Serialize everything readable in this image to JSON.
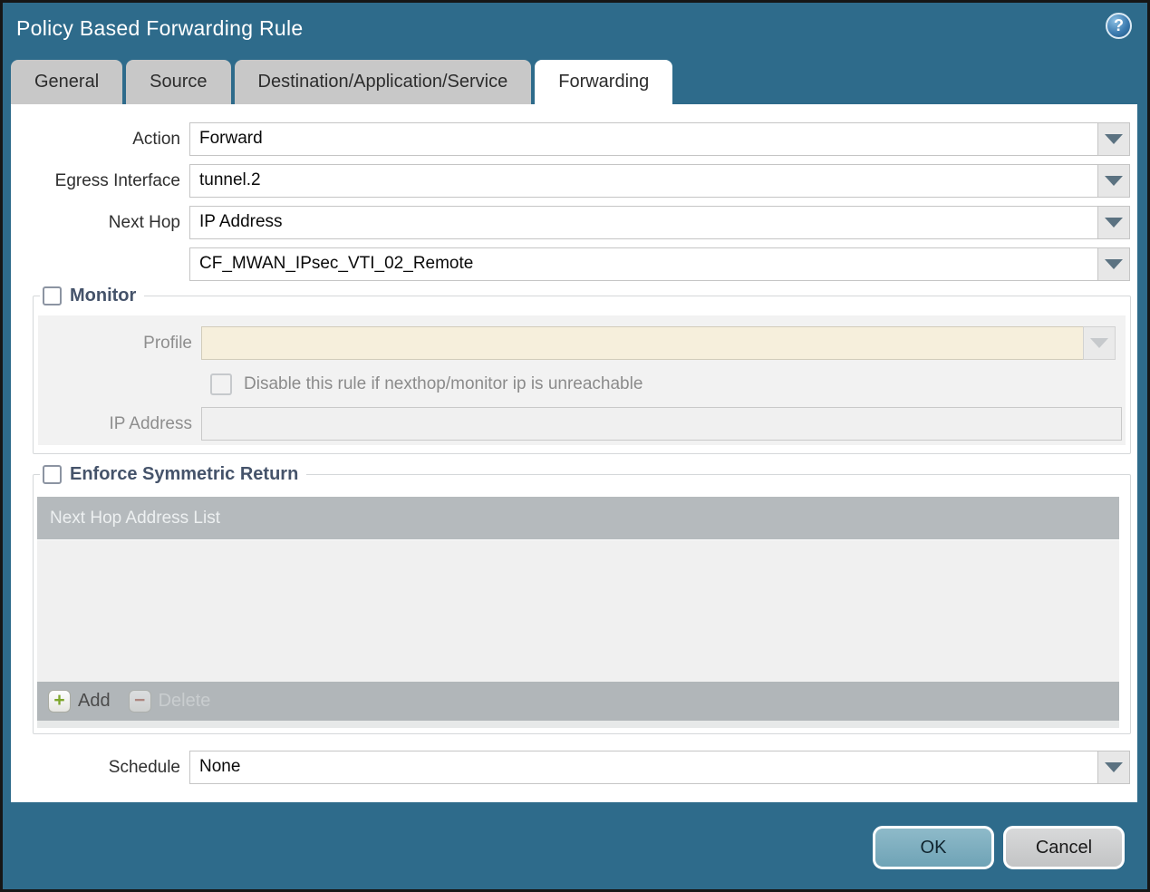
{
  "window": {
    "title": "Policy Based Forwarding Rule"
  },
  "icons": {
    "help": "?",
    "add": "+",
    "delete": "−"
  },
  "tabs": [
    {
      "label": "General",
      "active": false
    },
    {
      "label": "Source",
      "active": false
    },
    {
      "label": "Destination/Application/Service",
      "active": false
    },
    {
      "label": "Forwarding",
      "active": true
    }
  ],
  "form": {
    "action": {
      "label": "Action",
      "value": "Forward"
    },
    "egress_interface": {
      "label": "Egress Interface",
      "value": "tunnel.2"
    },
    "next_hop": {
      "label": "Next Hop",
      "value": "IP Address"
    },
    "next_hop_address": {
      "value": "CF_MWAN_IPsec_VTI_02_Remote"
    },
    "schedule": {
      "label": "Schedule",
      "value": "None"
    }
  },
  "monitor": {
    "title": "Monitor",
    "checked": false,
    "profile": {
      "label": "Profile",
      "value": ""
    },
    "disable_rule_label": "Disable this rule if nexthop/monitor ip is unreachable",
    "disable_rule_checked": false,
    "ip_address": {
      "label": "IP Address",
      "value": ""
    }
  },
  "enforce_symmetric_return": {
    "title": "Enforce Symmetric Return",
    "checked": false,
    "table": {
      "columns": [
        "Next Hop Address List"
      ],
      "rows": []
    },
    "toolbar": {
      "add_label": "Add",
      "delete_label": "Delete"
    }
  },
  "footer": {
    "ok_label": "OK",
    "cancel_label": "Cancel"
  },
  "colors": {
    "titlebar": "#2e6b8b",
    "tab_inactive": "#c8c8c8",
    "tab_active": "#ffffff",
    "section_title": "#45536a",
    "profile_disabled_field": "#f6efdc",
    "table_header": "#b5babd",
    "add_icon_green": "#7ea62c",
    "delete_icon_red": "#aa6253",
    "ok_button": "#6fa3b6",
    "cancel_button": "#c3c4c5"
  }
}
